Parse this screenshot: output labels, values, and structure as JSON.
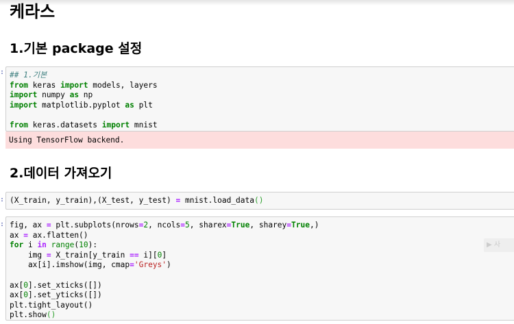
{
  "title": "케라스",
  "sections": [
    {
      "heading": "1.기본 package 설정"
    },
    {
      "heading": "2.데이터 가져오기"
    }
  ],
  "cells": [
    {
      "lines": [
        [
          [
            "cmt",
            "## 1.기본"
          ]
        ],
        [
          [
            "kw",
            "from"
          ],
          [
            "t",
            " keras "
          ],
          [
            "kw",
            "import"
          ],
          [
            "t",
            " models, layers"
          ]
        ],
        [
          [
            "kw",
            "import"
          ],
          [
            "t",
            " numpy "
          ],
          [
            "kw",
            "as"
          ],
          [
            "t",
            " np"
          ]
        ],
        [
          [
            "kw",
            "import"
          ],
          [
            "t",
            " matplotlib.pyplot "
          ],
          [
            "kw",
            "as"
          ],
          [
            "t",
            " plt"
          ]
        ],
        [
          [
            "t",
            ""
          ]
        ],
        [
          [
            "kw",
            "from"
          ],
          [
            "t",
            " keras.datasets "
          ],
          [
            "kw",
            "import"
          ],
          [
            "t",
            " mnist"
          ]
        ]
      ],
      "output": "Using TensorFlow backend."
    },
    {
      "lines": [
        [
          [
            "t",
            "(X_train, y_train),(X_test, y_test) "
          ],
          [
            "op",
            "="
          ],
          [
            "t",
            " mnist.load_data"
          ],
          [
            "paren",
            "()"
          ]
        ]
      ]
    },
    {
      "lines": [
        [
          [
            "t",
            "fig, ax "
          ],
          [
            "op",
            "="
          ],
          [
            "t",
            " plt.subplots(nrows"
          ],
          [
            "op",
            "="
          ],
          [
            "num",
            "2"
          ],
          [
            "t",
            ", ncols"
          ],
          [
            "op",
            "="
          ],
          [
            "num",
            "5"
          ],
          [
            "t",
            ", sharex"
          ],
          [
            "op",
            "="
          ],
          [
            "kw",
            "True"
          ],
          [
            "t",
            ", sharey"
          ],
          [
            "op",
            "="
          ],
          [
            "kw",
            "True"
          ],
          [
            "t",
            ",)"
          ]
        ],
        [
          [
            "t",
            "ax "
          ],
          [
            "op",
            "="
          ],
          [
            "t",
            " ax.flatten()"
          ]
        ],
        [
          [
            "kw",
            "for"
          ],
          [
            "t",
            " i "
          ],
          [
            "op",
            "in"
          ],
          [
            "t",
            " "
          ],
          [
            "bi",
            "range"
          ],
          [
            "t",
            "("
          ],
          [
            "num",
            "10"
          ],
          [
            "t",
            "):"
          ]
        ],
        [
          [
            "t",
            "    img "
          ],
          [
            "op",
            "="
          ],
          [
            "t",
            " X_train[y_train "
          ],
          [
            "op",
            "=="
          ],
          [
            "t",
            " i]["
          ],
          [
            "num",
            "0"
          ],
          [
            "t",
            "]"
          ]
        ],
        [
          [
            "t",
            "    ax[i].imshow(img, cmap"
          ],
          [
            "op",
            "="
          ],
          [
            "str",
            "'Greys'"
          ],
          [
            "t",
            ")"
          ]
        ],
        [
          [
            "t",
            ""
          ]
        ],
        [
          [
            "t",
            "ax["
          ],
          [
            "num",
            "0"
          ],
          [
            "t",
            "].set_xticks([])"
          ]
        ],
        [
          [
            "t",
            "ax["
          ],
          [
            "num",
            "0"
          ],
          [
            "t",
            "].set_yticks([])"
          ]
        ],
        [
          [
            "t",
            "plt.tight_layout()"
          ]
        ],
        [
          [
            "t",
            "plt.show"
          ],
          [
            "paren",
            "()"
          ]
        ]
      ]
    }
  ],
  "prompt_marker": ":",
  "ghost_button_label": "▶ 사"
}
